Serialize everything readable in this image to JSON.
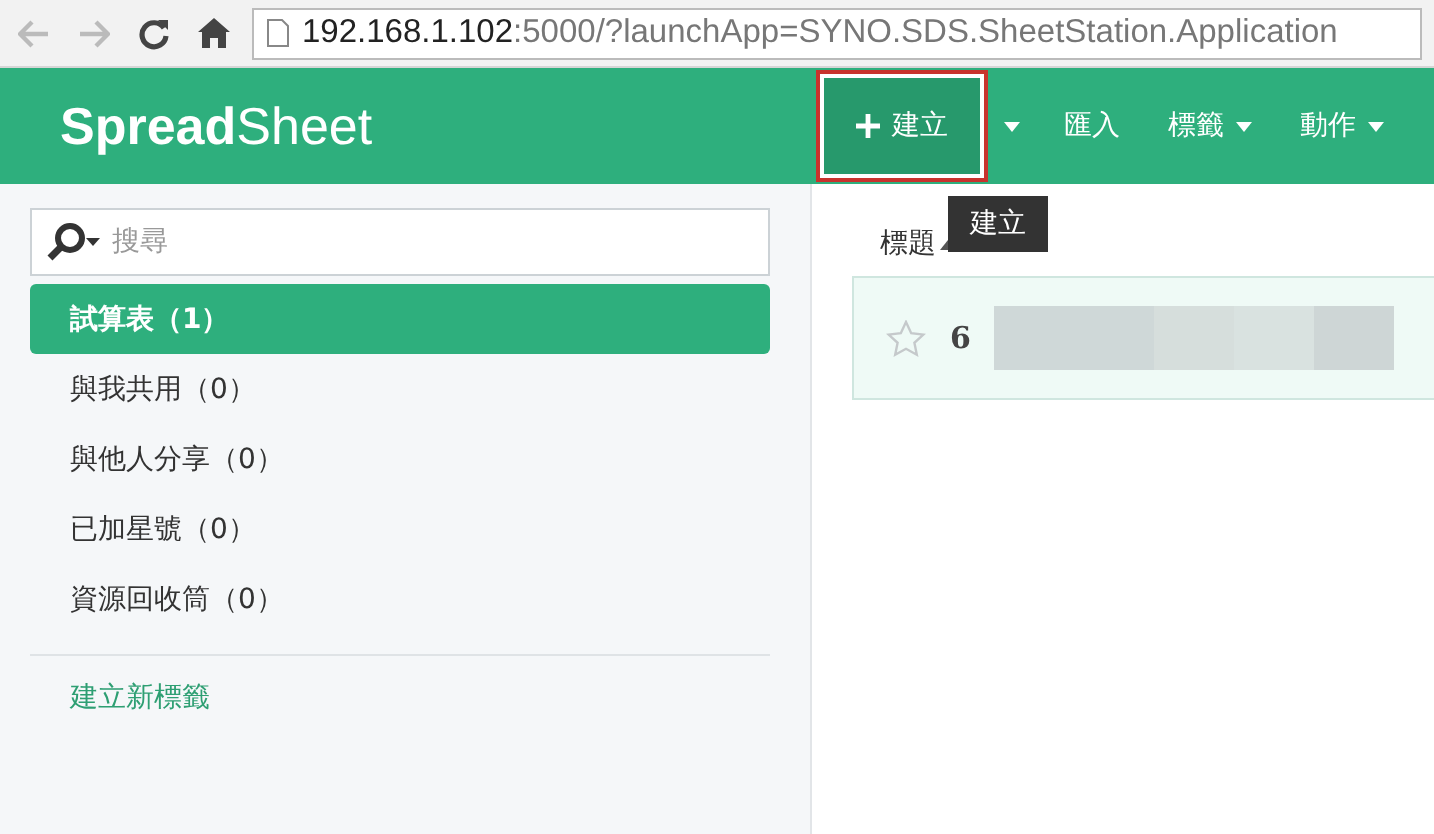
{
  "browser": {
    "url_host": "192.168.1.102",
    "url_rest": ":5000/?launchApp=SYNO.SDS.SheetStation.Application"
  },
  "header": {
    "logo_bold": "Spread",
    "logo_light": "Sheet",
    "nav": [
      {
        "kind": "primary",
        "label": "建立",
        "highlighted": true
      },
      {
        "kind": "caret",
        "highlighted": false
      },
      {
        "kind": "plain",
        "label": "匯入",
        "highlighted": false
      },
      {
        "kind": "menu",
        "label": "標籤",
        "highlighted": false
      },
      {
        "kind": "menu",
        "label": "動作",
        "highlighted": false
      }
    ]
  },
  "tooltip": "建立",
  "sidebar": {
    "search": {
      "placeholder": "搜尋"
    },
    "items": [
      {
        "label": "試算表（1）",
        "selected": true
      },
      {
        "label": "與我共用（0）",
        "selected": false
      },
      {
        "label": "與他人分享（0）",
        "selected": false
      },
      {
        "label": "已加星號（0）",
        "selected": false
      },
      {
        "label": "資源回收筒（0）",
        "selected": false
      }
    ],
    "new_tag_link": "建立新標籤"
  },
  "table": {
    "column_header": "標題",
    "rows": [
      {
        "title_start": "6",
        "starred": false,
        "redacted": true
      }
    ]
  }
}
